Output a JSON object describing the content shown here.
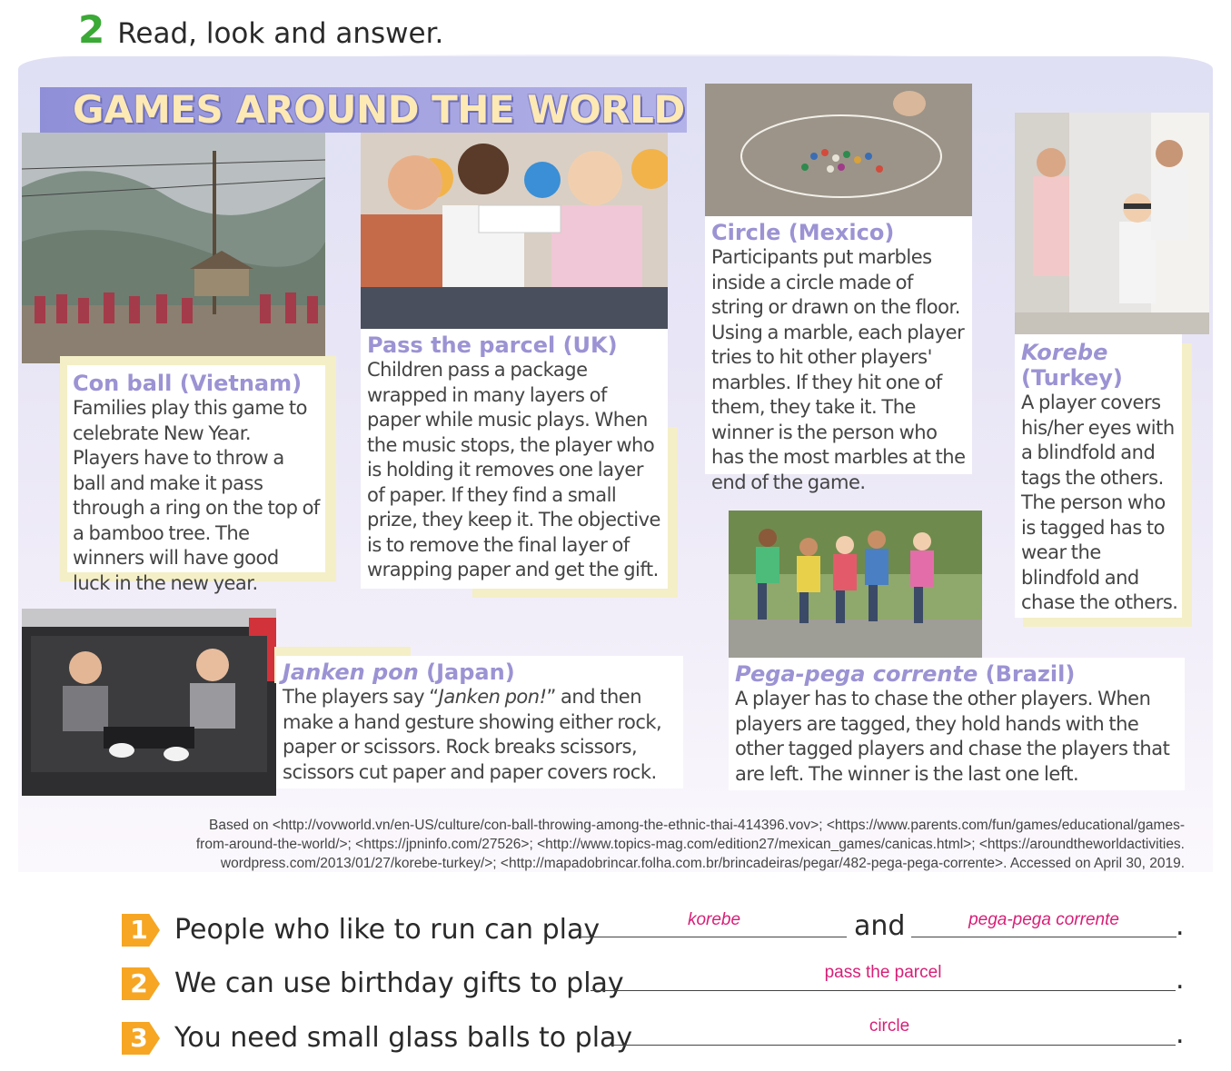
{
  "exercise": {
    "number": "2",
    "instruction": "Read, look and answer."
  },
  "banner": {
    "title": "GAMES AROUND THE WORLD"
  },
  "games": [
    {
      "name": "Con ball",
      "country": "(Vietnam)",
      "text": "Families play this game to celebrate New Year. Players have to throw a ball and make it pass through a ring on the top of a bamboo tree. The winners will have good luck in the new year."
    },
    {
      "name": "Pass the parcel",
      "country": "(UK)",
      "text": "Children pass a package wrapped in many layers of paper while music plays. When the music stops, the player who is holding it removes one layer of paper. If they find a small prize, they keep it. The objective is to remove the final layer of wrapping paper and get the gift."
    },
    {
      "name": "Circle",
      "country": "(Mexico)",
      "text": "Participants put marbles inside a circle made of string or drawn on the floor. Using a marble, each player tries to hit other players' marbles. If they hit one of them, they take it. The winner is the person who has the most marbles at the end of the game."
    },
    {
      "name": "Korebe",
      "country": "(Turkey)",
      "text": "A player covers his/her eyes with a blindfold and tags the others. The person who is tagged has to wear the blindfold and chase the others."
    },
    {
      "name": "Janken pon",
      "country": "(Japan)",
      "text_before": "The players say “",
      "text_italic": "Janken pon!",
      "text_after": "” and then make a hand gesture showing either rock, paper or scissors. Rock breaks scissors, scissors cut paper and paper covers rock."
    },
    {
      "name": "Pega-pega corrente",
      "country": "(Brazil)",
      "text": "A player has to chase the other players. When players are tagged, they hold hands with the other tagged players and chase the players that are left. The winner is the last one left."
    }
  ],
  "source": {
    "line1": "Based on <http://vovworld.vn/en-US/culture/con-ball-throwing-among-the-ethnic-thai-414396.vov>; <https://www.parents.com/fun/games/educational/games-",
    "line2": "from-around-the-world/>; <https://jpninfo.com/27526>; <http://www.topics-mag.com/edition27/mexican_games/canicas.html>; <https://aroundtheworldactivities.",
    "line3": "wordpress.com/2013/01/27/korebe-turkey/>; <http://mapadobrincar.folha.com.br/brincadeiras/pegar/482-pega-pega-corrente>. Accessed on April 30, 2019."
  },
  "questions": [
    {
      "number": "1",
      "text": "People who like to run can play",
      "connector": "and",
      "answer1": "korebe",
      "answer2": "pega-pega corrente",
      "end": "."
    },
    {
      "number": "2",
      "text": "We can use birthday gifts to play",
      "answer1": "pass the parcel",
      "end": "."
    },
    {
      "number": "3",
      "text": "You need small glass balls to play",
      "answer1": "circle",
      "end": "."
    }
  ],
  "colors": {
    "accent_green": "#3aa935",
    "title_purple": "#9b93d3",
    "banner_text": "#fde9b4",
    "answer_pink": "#d61f77",
    "badge_orange": "#f6a623"
  }
}
